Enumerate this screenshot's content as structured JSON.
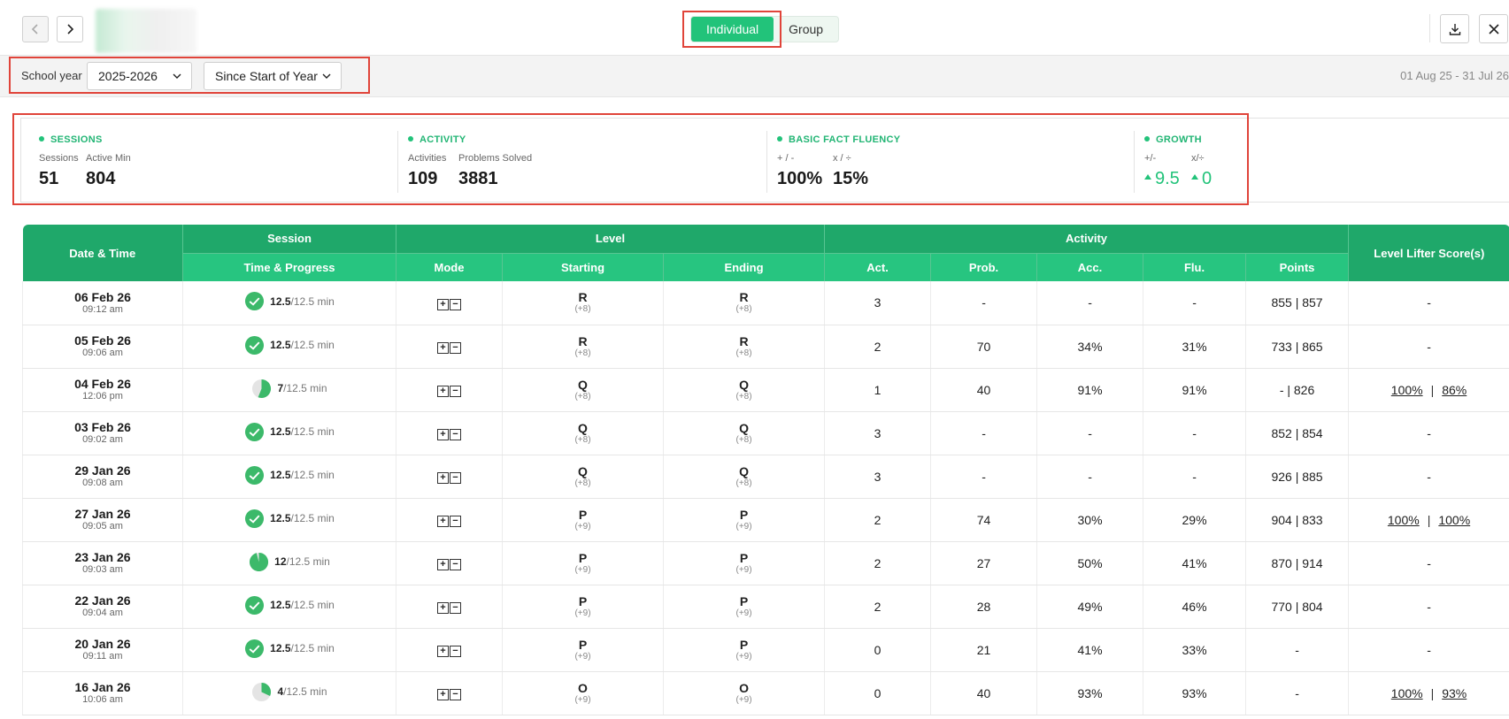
{
  "header": {
    "tabs": [
      {
        "label": "Individual",
        "active": true
      },
      {
        "label": "Group",
        "active": false
      }
    ]
  },
  "filters": {
    "school_year_label": "School year",
    "school_year_value": "2025-2026",
    "range_value": "Since Start of Year",
    "date_range": "01 Aug 25 - 31 Jul 26"
  },
  "stats": {
    "sessions": {
      "title": "SESSIONS",
      "sub1": "Sessions",
      "val1": "51",
      "sub2": "Active Min",
      "val2": "804"
    },
    "activity": {
      "title": "ACTIVITY",
      "sub1": "Activities",
      "val1": "109",
      "sub2": "Problems Solved",
      "val2": "3881"
    },
    "fluency": {
      "title": "BASIC FACT FLUENCY",
      "sub1": "+ / -",
      "val1": "100%",
      "sub2": "x / ÷",
      "val2": "15%"
    },
    "growth": {
      "title": "GROWTH",
      "sub1": "+/-",
      "val1": "9.5",
      "sub2": "x/÷",
      "val2": "0"
    }
  },
  "table": {
    "headers": {
      "date_time": "Date & Time",
      "session": "Session",
      "level": "Level",
      "activity": "Activity",
      "level_lifter": "Level Lifter Score(s)",
      "time_progress": "Time & Progress",
      "mode": "Mode",
      "starting": "Starting",
      "ending": "Ending",
      "act": "Act.",
      "prob": "Prob.",
      "acc": "Acc.",
      "flu": "Flu.",
      "points": "Points"
    },
    "rows": [
      {
        "date": "06 Feb 26",
        "time": "09:12 am",
        "progress_done": "12.5",
        "progress_of": "/12.5 min",
        "complete": true,
        "fraction": 1.0,
        "start": "R",
        "start_sub": "(+8)",
        "end": "R",
        "end_sub": "(+8)",
        "act": "3",
        "prob": "-",
        "acc": "-",
        "flu": "-",
        "points": "855 | 857",
        "ll1": "-",
        "ll2": ""
      },
      {
        "date": "05 Feb 26",
        "time": "09:06 am",
        "progress_done": "12.5",
        "progress_of": "/12.5 min",
        "complete": true,
        "fraction": 1.0,
        "start": "R",
        "start_sub": "(+8)",
        "end": "R",
        "end_sub": "(+8)",
        "act": "2",
        "prob": "70",
        "acc": "34%",
        "flu": "31%",
        "points": "733 | 865",
        "ll1": "-",
        "ll2": ""
      },
      {
        "date": "04 Feb 26",
        "time": "12:06 pm",
        "progress_done": "7",
        "progress_of": "/12.5 min",
        "complete": false,
        "fraction": 0.56,
        "start": "Q",
        "start_sub": "(+8)",
        "end": "Q",
        "end_sub": "(+8)",
        "act": "1",
        "prob": "40",
        "acc": "91%",
        "flu": "91%",
        "points": "- | 826",
        "ll1": "100%",
        "ll2": "86%"
      },
      {
        "date": "03 Feb 26",
        "time": "09:02 am",
        "progress_done": "12.5",
        "progress_of": "/12.5 min",
        "complete": true,
        "fraction": 1.0,
        "start": "Q",
        "start_sub": "(+8)",
        "end": "Q",
        "end_sub": "(+8)",
        "act": "3",
        "prob": "-",
        "acc": "-",
        "flu": "-",
        "points": "852 | 854",
        "ll1": "-",
        "ll2": ""
      },
      {
        "date": "29 Jan 26",
        "time": "09:08 am",
        "progress_done": "12.5",
        "progress_of": "/12.5 min",
        "complete": true,
        "fraction": 1.0,
        "start": "Q",
        "start_sub": "(+8)",
        "end": "Q",
        "end_sub": "(+8)",
        "act": "3",
        "prob": "-",
        "acc": "-",
        "flu": "-",
        "points": "926 | 885",
        "ll1": "-",
        "ll2": ""
      },
      {
        "date": "27 Jan 26",
        "time": "09:05 am",
        "progress_done": "12.5",
        "progress_of": "/12.5 min",
        "complete": true,
        "fraction": 1.0,
        "start": "P",
        "start_sub": "(+9)",
        "end": "P",
        "end_sub": "(+9)",
        "act": "2",
        "prob": "74",
        "acc": "30%",
        "flu": "29%",
        "points": "904 | 833",
        "ll1": "100%",
        "ll2": "100%"
      },
      {
        "date": "23 Jan 26",
        "time": "09:03 am",
        "progress_done": "12",
        "progress_of": "/12.5 min",
        "complete": false,
        "fraction": 0.96,
        "start": "P",
        "start_sub": "(+9)",
        "end": "P",
        "end_sub": "(+9)",
        "act": "2",
        "prob": "27",
        "acc": "50%",
        "flu": "41%",
        "points": "870 | 914",
        "ll1": "-",
        "ll2": ""
      },
      {
        "date": "22 Jan 26",
        "time": "09:04 am",
        "progress_done": "12.5",
        "progress_of": "/12.5 min",
        "complete": true,
        "fraction": 1.0,
        "start": "P",
        "start_sub": "(+9)",
        "end": "P",
        "end_sub": "(+9)",
        "act": "2",
        "prob": "28",
        "acc": "49%",
        "flu": "46%",
        "points": "770 | 804",
        "ll1": "-",
        "ll2": ""
      },
      {
        "date": "20 Jan 26",
        "time": "09:11 am",
        "progress_done": "12.5",
        "progress_of": "/12.5 min",
        "complete": true,
        "fraction": 1.0,
        "start": "P",
        "start_sub": "(+9)",
        "end": "P",
        "end_sub": "(+9)",
        "act": "0",
        "prob": "21",
        "acc": "41%",
        "flu": "33%",
        "points": "-",
        "ll1": "-",
        "ll2": ""
      },
      {
        "date": "16 Jan 26",
        "time": "10:06 am",
        "progress_done": "4",
        "progress_of": "/12.5 min",
        "complete": false,
        "fraction": 0.32,
        "start": "O",
        "start_sub": "(+9)",
        "end": "O",
        "end_sub": "(+9)",
        "act": "0",
        "prob": "40",
        "acc": "93%",
        "flu": "93%",
        "points": "-",
        "ll1": "100%",
        "ll2": "93%"
      }
    ]
  },
  "colors": {
    "accent": "#22c37a",
    "header_dark": "#1fa86a",
    "header_light": "#27c580",
    "highlight": "#e0443a"
  }
}
